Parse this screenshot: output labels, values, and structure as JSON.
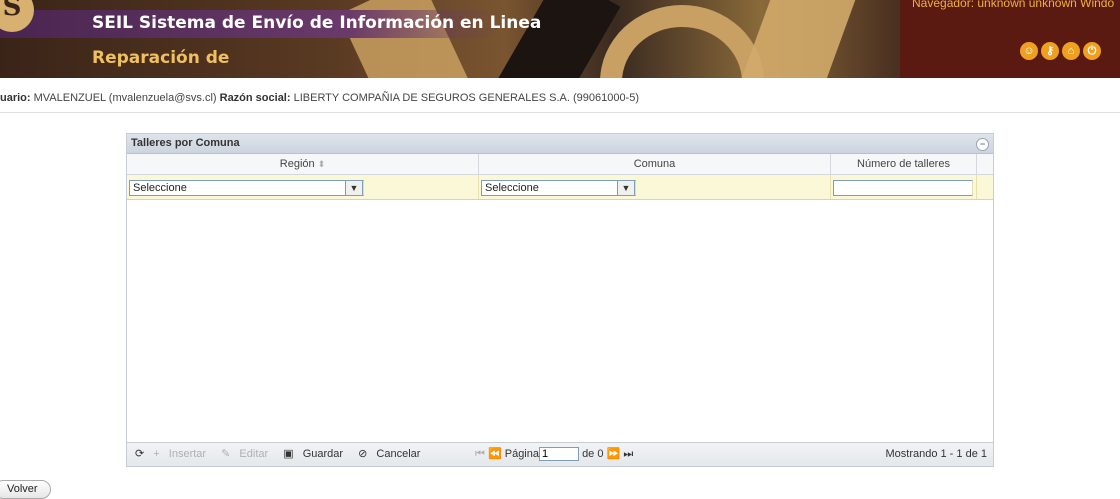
{
  "header": {
    "logo_text": "S",
    "title": "SEIL Sistema de Envío de Información en Linea",
    "subtitle": "Reparación de",
    "browser_info": "Navegador: unknown unknown Windo",
    "icons": [
      "user-icon",
      "key-icon",
      "home-icon",
      "power-icon"
    ],
    "accent_color": "#f0c060"
  },
  "user": {
    "usuario_label": "uario:",
    "usuario_value": "MVALENZUEL (mvalenzuela@svs.cl)",
    "razon_label": "Razón social:",
    "razon_value": "LIBERTY COMPAÑIA DE SEGUROS GENERALES S.A. (99061000-5)"
  },
  "grid": {
    "caption": "Talleres por Comuna",
    "columns": [
      "Región",
      "Comuna",
      "Número de talleres"
    ],
    "edit_row": {
      "region_value": "Seleccione",
      "comuna_value": "Seleccione",
      "numero_value": ""
    },
    "toolbar": {
      "refresh": "",
      "insertar": "Insertar",
      "editar": "Editar",
      "guardar": "Guardar",
      "cancelar": "Cancelar"
    },
    "pager": {
      "pagina_label": "Página",
      "page_value": "1",
      "de_label": "de 0",
      "showing": "Mostrando 1 - 1 de 1"
    }
  },
  "footer": {
    "volver": "Volver"
  }
}
